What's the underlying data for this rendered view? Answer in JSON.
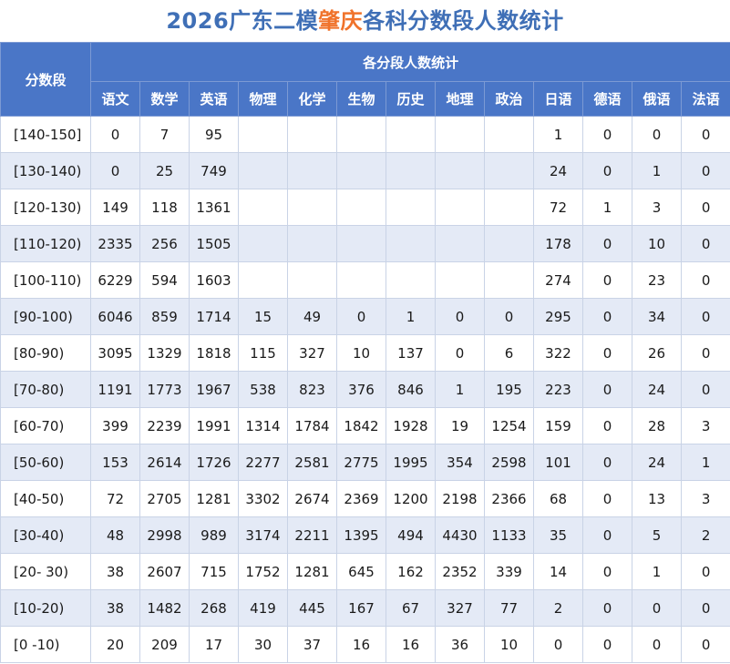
{
  "title": {
    "prefix": "2026广东二模",
    "highlight": "肇庆",
    "suffix": "各科分数段人数统计"
  },
  "header": {
    "range_col": "分数段",
    "group": "各分段人数统计",
    "subjects": [
      "语文",
      "数学",
      "英语",
      "物理",
      "化学",
      "生物",
      "历史",
      "地理",
      "政治",
      "日语",
      "德语",
      "俄语",
      "法语"
    ]
  },
  "rows": [
    {
      "range": "[140-150]",
      "cells": [
        "0",
        "7",
        "95",
        "",
        "",
        "",
        "",
        "",
        "",
        "1",
        "0",
        "0",
        "0"
      ]
    },
    {
      "range": "[130-140)",
      "cells": [
        "0",
        "25",
        "749",
        "",
        "",
        "",
        "",
        "",
        "",
        "24",
        "0",
        "1",
        "0"
      ]
    },
    {
      "range": "[120-130)",
      "cells": [
        "149",
        "118",
        "1361",
        "",
        "",
        "",
        "",
        "",
        "",
        "72",
        "1",
        "3",
        "0"
      ]
    },
    {
      "range": "[110-120)",
      "cells": [
        "2335",
        "256",
        "1505",
        "",
        "",
        "",
        "",
        "",
        "",
        "178",
        "0",
        "10",
        "0"
      ]
    },
    {
      "range": "[100-110)",
      "cells": [
        "6229",
        "594",
        "1603",
        "",
        "",
        "",
        "",
        "",
        "",
        "274",
        "0",
        "23",
        "0"
      ]
    },
    {
      "range": "[90-100)",
      "cells": [
        "6046",
        "859",
        "1714",
        "15",
        "49",
        "0",
        "1",
        "0",
        "0",
        "295",
        "0",
        "34",
        "0"
      ]
    },
    {
      "range": "[80-90)",
      "cells": [
        "3095",
        "1329",
        "1818",
        "115",
        "327",
        "10",
        "137",
        "0",
        "6",
        "322",
        "0",
        "26",
        "0"
      ]
    },
    {
      "range": "[70-80)",
      "cells": [
        "1191",
        "1773",
        "1967",
        "538",
        "823",
        "376",
        "846",
        "1",
        "195",
        "223",
        "0",
        "24",
        "0"
      ]
    },
    {
      "range": "[60-70)",
      "cells": [
        "399",
        "2239",
        "1991",
        "1314",
        "1784",
        "1842",
        "1928",
        "19",
        "1254",
        "159",
        "0",
        "28",
        "3"
      ]
    },
    {
      "range": "[50-60)",
      "cells": [
        "153",
        "2614",
        "1726",
        "2277",
        "2581",
        "2775",
        "1995",
        "354",
        "2598",
        "101",
        "0",
        "24",
        "1"
      ]
    },
    {
      "range": "[40-50)",
      "cells": [
        "72",
        "2705",
        "1281",
        "3302",
        "2674",
        "2369",
        "1200",
        "2198",
        "2366",
        "68",
        "0",
        "13",
        "3"
      ]
    },
    {
      "range": "[30-40)",
      "cells": [
        "48",
        "2998",
        "989",
        "3174",
        "2211",
        "1395",
        "494",
        "4430",
        "1133",
        "35",
        "0",
        "5",
        "2"
      ]
    },
    {
      "range": "[20- 30)",
      "cells": [
        "38",
        "2607",
        "715",
        "1752",
        "1281",
        "645",
        "162",
        "2352",
        "339",
        "14",
        "0",
        "1",
        "0"
      ]
    },
    {
      "range": "[10-20)",
      "cells": [
        "38",
        "1482",
        "268",
        "419",
        "445",
        "167",
        "67",
        "327",
        "77",
        "2",
        "0",
        "0",
        "0"
      ]
    },
    {
      "range": "[0 -10)",
      "cells": [
        "20",
        "209",
        "17",
        "30",
        "37",
        "16",
        "16",
        "36",
        "10",
        "0",
        "0",
        "0",
        "0"
      ]
    }
  ]
}
